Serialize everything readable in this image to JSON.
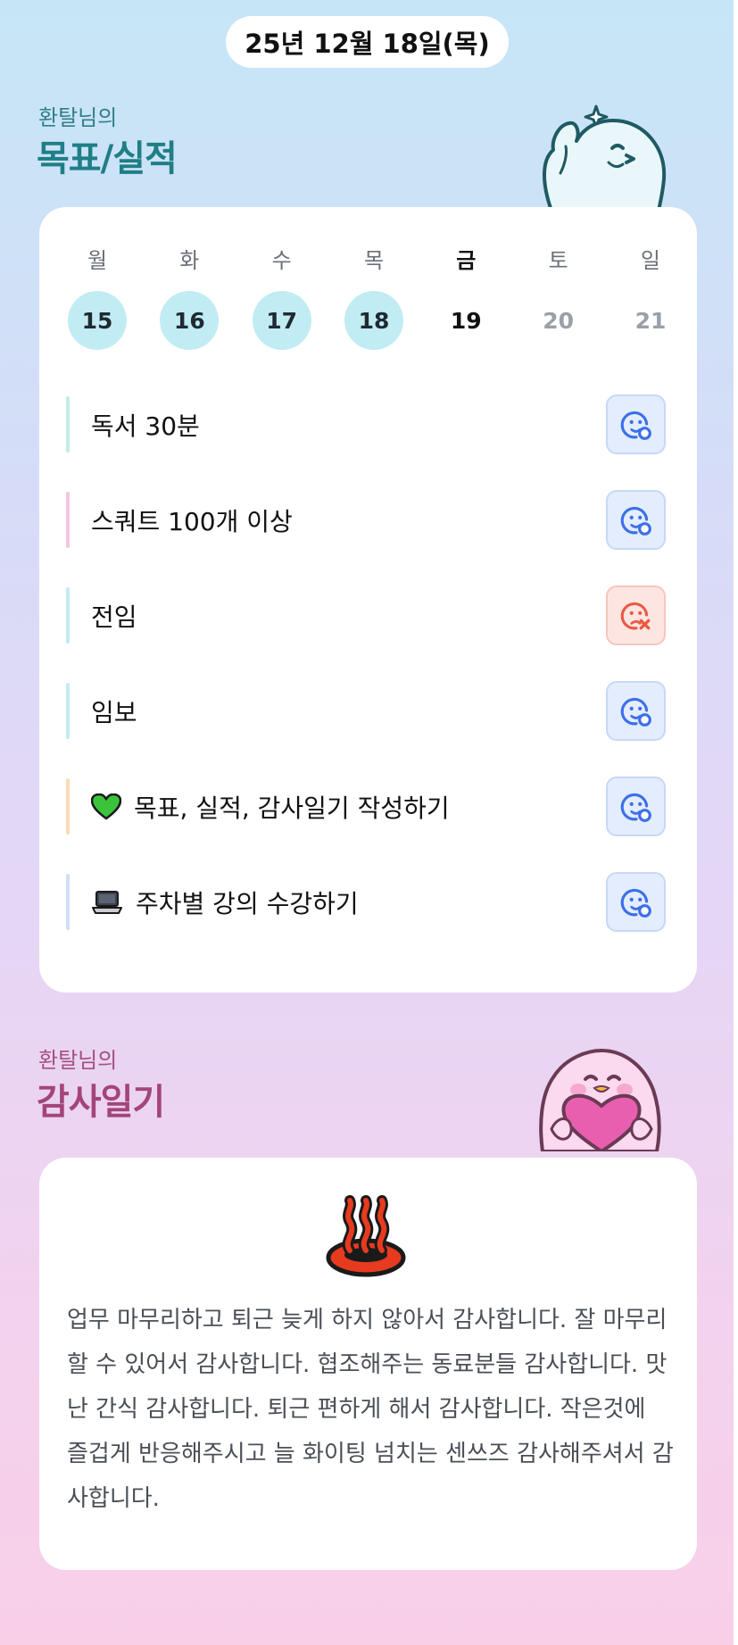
{
  "header": {
    "date": "25년 12월 18일(목)"
  },
  "goals_section": {
    "subtitle": "환탈님의",
    "title": "목표/실적",
    "week": [
      {
        "day": "월",
        "date": "15",
        "state": "done"
      },
      {
        "day": "화",
        "date": "16",
        "state": "done"
      },
      {
        "day": "수",
        "date": "17",
        "state": "done"
      },
      {
        "day": "목",
        "date": "18",
        "state": "done"
      },
      {
        "day": "금",
        "date": "19",
        "state": "today"
      },
      {
        "day": "토",
        "date": "20",
        "state": "future"
      },
      {
        "day": "일",
        "date": "21",
        "state": "future"
      }
    ],
    "goals": [
      {
        "text": "독서 30분",
        "icon": "",
        "status": "success",
        "bar_color": "#bfeee6"
      },
      {
        "text": "스쿼트 100개 이상",
        "icon": "",
        "status": "success",
        "bar_color": "#f6c5e2"
      },
      {
        "text": "전임",
        "icon": "",
        "status": "fail",
        "bar_color": "#c2ecf4"
      },
      {
        "text": "임보",
        "icon": "",
        "status": "success",
        "bar_color": "#c2ecf4"
      },
      {
        "text": "목표, 실적, 감사일기 작성하기",
        "icon": "green-heart-icon",
        "status": "success",
        "bar_color": "#f9ddb8"
      },
      {
        "text": "주차별 강의 수강하기",
        "icon": "laptop-icon",
        "status": "success",
        "bar_color": "#d3dcf8"
      }
    ]
  },
  "diary_section": {
    "subtitle": "환탈님의",
    "title": "감사일기",
    "icon": "hot-springs-icon",
    "text": "업무 마무리하고 퇴근 늦게 하지 않아서 감사합니다. 잘 마무리 할 수 있어서 감사합니다. 협조해주는 동료분들 감사합니다. 맛난 간식 감사합니다. 퇴근 편하게 해서 감사합니다. 작은것에 즐겁게 반응해주시고 늘 화이팅 넘치는 센쓰즈 감사해주셔서 감사합니다."
  },
  "colors": {
    "goals_title": "#1f7e86",
    "diary_title": "#a3457a",
    "success": "#3d6fe8",
    "fail": "#ea5a45"
  }
}
